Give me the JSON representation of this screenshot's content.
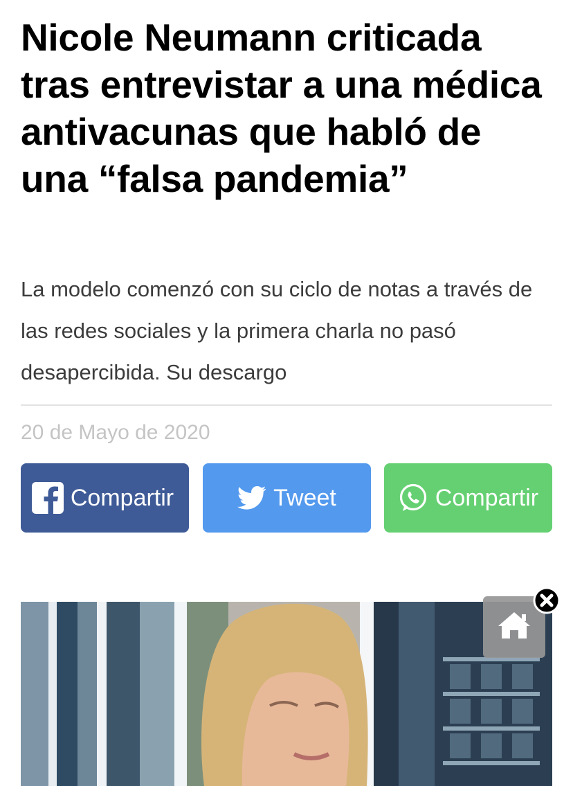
{
  "article": {
    "headline": "Nicole Neumann criticada tras entrevistar a una médica antivacunas que habló de una “falsa pandemia”",
    "subheadline": "La modelo comenzó con su ciclo de notas a través de las redes sociales y la primera charla no pasó desapercibida. Su descargo",
    "date": "20 de Mayo de 2020"
  },
  "share": {
    "facebook": {
      "label": "Compartir",
      "icon": "facebook-icon",
      "color": "#3f5b97"
    },
    "twitter": {
      "label": "Tweet",
      "icon": "twitter-bird-icon",
      "color": "#5399ee"
    },
    "whatsapp": {
      "label": "Compartir",
      "icon": "whatsapp-icon",
      "color": "#65d072"
    }
  },
  "overlay": {
    "home_icon": "home-icon",
    "close_icon": "close-icon"
  },
  "colors": {
    "headline": "#000000",
    "subheadline": "#3c3c3c",
    "date": "#c4c4c4",
    "divider": "#e2e2e2"
  }
}
